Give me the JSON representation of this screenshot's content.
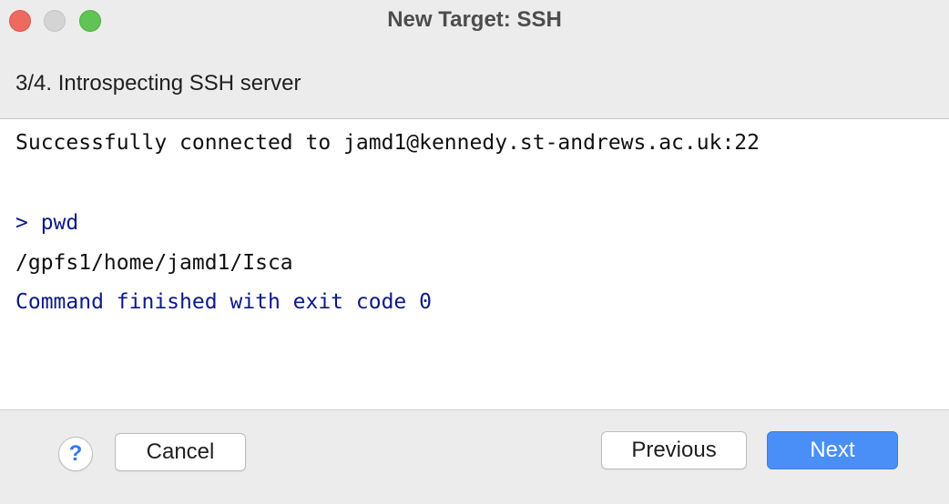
{
  "window": {
    "title": "New Target: SSH"
  },
  "step": {
    "title": "3/4. Introspecting SSH server"
  },
  "console": {
    "lines": [
      {
        "text": "Successfully connected to jamd1@kennedy.st-andrews.ac.uk:22",
        "kind": "normal"
      },
      {
        "text": "> pwd",
        "kind": "system"
      },
      {
        "text": "/gpfs1/home/jamd1/Isca",
        "kind": "normal"
      },
      {
        "text": "Command finished with exit code 0",
        "kind": "system"
      }
    ]
  },
  "footer": {
    "help_label": "?",
    "cancel_label": "Cancel",
    "previous_label": "Previous",
    "next_label": "Next"
  },
  "colors": {
    "console_system_text": "#0b1a87",
    "primary_button": "#4a8ff8",
    "help_icon": "#3478f6"
  }
}
